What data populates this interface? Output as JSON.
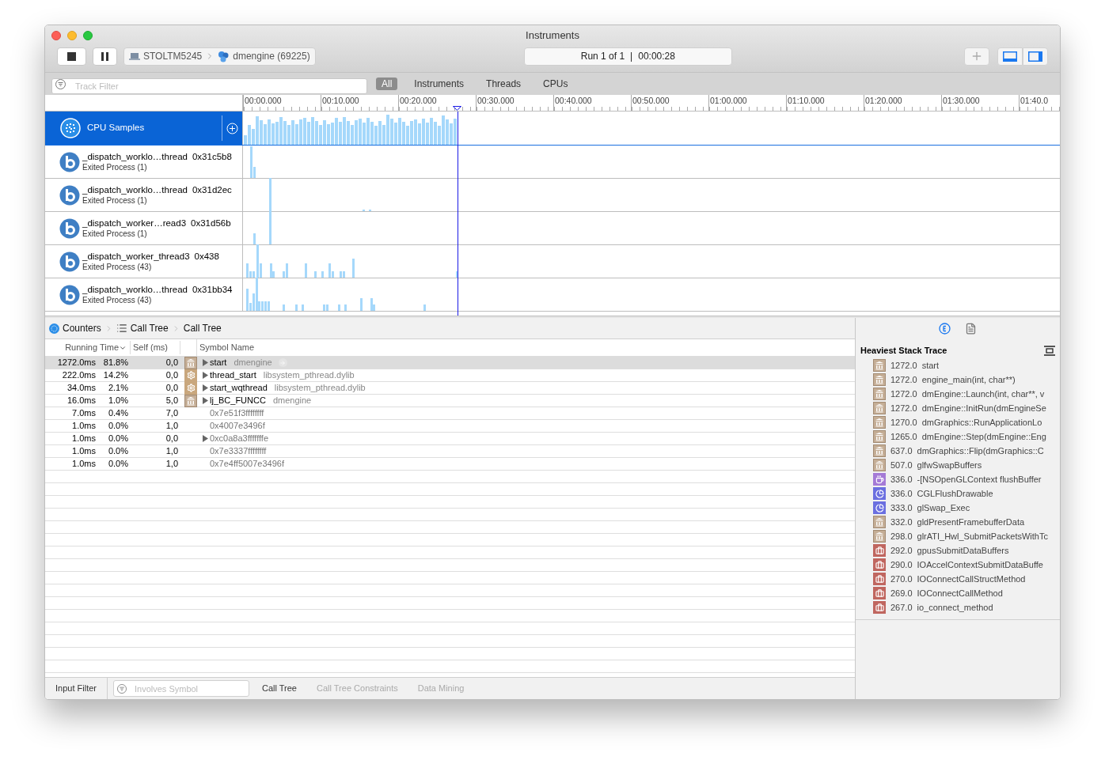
{
  "window": {
    "title": "Instruments"
  },
  "toolbar": {
    "target_device": "STOLTM5245",
    "target_process": "dmengine (69225)",
    "run": "Run 1 of 1",
    "separator": "|",
    "elapsed": "00:00:28",
    "view_toggles": [
      {
        "selected": true
      },
      {
        "selected": true
      }
    ]
  },
  "filter_bar": {
    "placeholder": "Track Filter",
    "tabs": [
      {
        "label": "All",
        "selected": true
      },
      {
        "label": "Instruments",
        "selected": false
      },
      {
        "label": "Threads",
        "selected": false
      },
      {
        "label": "CPUs",
        "selected": false
      }
    ]
  },
  "timeline": {
    "ticks": [
      "00:00.000",
      "00:10.000",
      "00:20.000",
      "00:30.000",
      "00:40.000",
      "00:50.000",
      "01:00.000",
      "01:10.000",
      "01:20.000",
      "01:30.000",
      "01:40.0"
    ]
  },
  "tracks": [
    {
      "kind": "instrument",
      "name": "CPU Samples",
      "selected": true
    },
    {
      "kind": "thread",
      "name": "_dispatch_worklo…thread",
      "thread_id": "0x31c5b8",
      "subtitle": "Exited Process (1)",
      "selected": false
    },
    {
      "kind": "thread",
      "name": "_dispatch_worklo…thread",
      "thread_id": "0x31d2ec",
      "subtitle": "Exited Process (1)",
      "selected": false
    },
    {
      "kind": "thread",
      "name": "_dispatch_worker…read3",
      "thread_id": "0x31d56b",
      "subtitle": "Exited Process (1)",
      "selected": false
    },
    {
      "kind": "thread",
      "name": "_dispatch_worker_thread3",
      "thread_id": "0x438",
      "subtitle": "Exited Process (43)",
      "selected": false
    },
    {
      "kind": "thread",
      "name": "_dispatch_worklo…thread",
      "thread_id": "0x31bb34",
      "subtitle": "Exited Process (43)",
      "selected": false
    }
  ],
  "breadcrumb": [
    "Counters",
    "Call Tree",
    "Call Tree"
  ],
  "call_tree": {
    "columns": [
      "Running Time",
      "Self (ms)",
      "Symbol Name"
    ],
    "rows": [
      {
        "time": "1272.0ms",
        "percent": "81.8%",
        "self": "0,0",
        "kind": "library",
        "expandable": true,
        "symbol": "start",
        "library": "dmengine",
        "selected": true
      },
      {
        "time": "222.0ms",
        "percent": "14.2%",
        "self": "0,0",
        "kind": "gear",
        "expandable": true,
        "symbol": "thread_start",
        "library": "libsystem_pthread.dylib",
        "selected": false
      },
      {
        "time": "34.0ms",
        "percent": "2.1%",
        "self": "0,0",
        "kind": "gear",
        "expandable": true,
        "symbol": "start_wqthread",
        "library": "libsystem_pthread.dylib",
        "selected": false
      },
      {
        "time": "16.0ms",
        "percent": "1.0%",
        "self": "5,0",
        "kind": "library",
        "expandable": true,
        "symbol": "lj_BC_FUNCC",
        "library": "dmengine",
        "selected": false
      },
      {
        "time": "7.0ms",
        "percent": "0.4%",
        "self": "7,0",
        "kind": "address",
        "expandable": false,
        "symbol": "0x7e51f3ffffffff",
        "selected": false
      },
      {
        "time": "1.0ms",
        "percent": "0.0%",
        "self": "1,0",
        "kind": "address",
        "expandable": false,
        "symbol": "0x4007e3496f",
        "selected": false
      },
      {
        "time": "1.0ms",
        "percent": "0.0%",
        "self": "0,0",
        "kind": "address",
        "expandable": true,
        "symbol": "0xc0a8a3fffffffe",
        "selected": false
      },
      {
        "time": "1.0ms",
        "percent": "0.0%",
        "self": "1,0",
        "kind": "address",
        "expandable": false,
        "symbol": "0x7e3337ffffffff",
        "selected": false
      },
      {
        "time": "1.0ms",
        "percent": "0.0%",
        "self": "1,0",
        "kind": "address",
        "expandable": false,
        "symbol": "0x7e4ff5007e3496f",
        "selected": false
      }
    ]
  },
  "bottom_bar": {
    "label": "Input Filter",
    "placeholder": "Involves Symbol",
    "tabs": [
      {
        "label": "Call Tree",
        "selected": true
      },
      {
        "label": "Call Tree Constraints",
        "selected": false
      },
      {
        "label": "Data Mining",
        "selected": false
      }
    ]
  },
  "inspector": {
    "tabs": [
      {
        "selected": true
      },
      {
        "selected": false
      }
    ],
    "title": "Heaviest Stack Trace",
    "rows": [
      {
        "weight": "1272.0",
        "symbol": "start",
        "kind": "library"
      },
      {
        "weight": "1272.0",
        "symbol": "engine_main(int, char**)",
        "kind": "library"
      },
      {
        "weight": "1272.0",
        "symbol": "dmEngine::Launch(int, char**, v",
        "kind": "library"
      },
      {
        "weight": "1272.0",
        "symbol": "dmEngine::InitRun(dmEngineSe",
        "kind": "library"
      },
      {
        "weight": "1270.0",
        "symbol": "dmGraphics::RunApplicationLo",
        "kind": "library"
      },
      {
        "weight": "1265.0",
        "symbol": "dmEngine::Step(dmEngine::Eng",
        "kind": "library"
      },
      {
        "weight": "637.0",
        "symbol": "dmGraphics::Flip(dmGraphics::C",
        "kind": "library"
      },
      {
        "weight": "507.0",
        "symbol": "glfwSwapBuffers",
        "kind": "library"
      },
      {
        "weight": "336.0",
        "symbol": "-[NSOpenGLContext flushBuffer",
        "kind": "objc"
      },
      {
        "weight": "336.0",
        "symbol": "CGLFlushDrawable",
        "kind": "graphics"
      },
      {
        "weight": "333.0",
        "symbol": "glSwap_Exec",
        "kind": "graphics"
      },
      {
        "weight": "332.0",
        "symbol": "gldPresentFramebufferData",
        "kind": "library"
      },
      {
        "weight": "298.0",
        "symbol": "glrATI_Hwl_SubmitPacketsWithTc",
        "kind": "library"
      },
      {
        "weight": "292.0",
        "symbol": "gpusSubmitDataBuffers",
        "kind": "kernel"
      },
      {
        "weight": "290.0",
        "symbol": "IOAccelContextSubmitDataBuffe",
        "kind": "kernel"
      },
      {
        "weight": "270.0",
        "symbol": "IOConnectCallStructMethod",
        "kind": "kernel"
      },
      {
        "weight": "269.0",
        "symbol": "IOConnectCallMethod",
        "kind": "kernel"
      },
      {
        "weight": "267.0",
        "symbol": "io_connect_method",
        "kind": "kernel"
      }
    ]
  }
}
